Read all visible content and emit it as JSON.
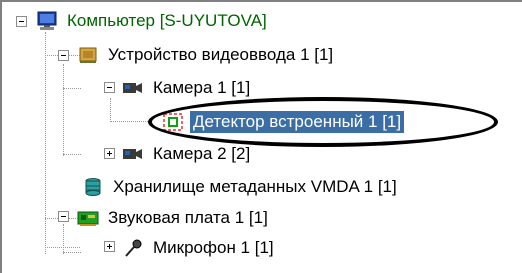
{
  "tree": {
    "root": {
      "label": "Компьютер [S-UYUTOVA]",
      "icon": "computer-icon",
      "expanded": true
    },
    "nodes": [
      {
        "label": "Устройство видеоввода 1 [1]",
        "icon": "capture-card-icon",
        "expanded": true
      },
      {
        "label": "Камера 1 [1]",
        "icon": "camera-icon",
        "expanded": true
      },
      {
        "label": "Детектор встроенный 1 [1]",
        "icon": "detector-icon",
        "selected": true
      },
      {
        "label": "Камера 2 [2]",
        "icon": "camera-icon",
        "expanded": false
      },
      {
        "label": "Хранилище метаданных VMDA 1 [1]",
        "icon": "database-icon"
      },
      {
        "label": "Звуковая плата 1 [1]",
        "icon": "sound-card-icon",
        "expanded": true
      },
      {
        "label": "Микрофон 1 [1]",
        "icon": "microphone-icon",
        "expanded": false
      }
    ]
  },
  "colors": {
    "root_text": "#006400",
    "selection_bg": "#3a6ea5",
    "selection_text": "#ffffff"
  }
}
